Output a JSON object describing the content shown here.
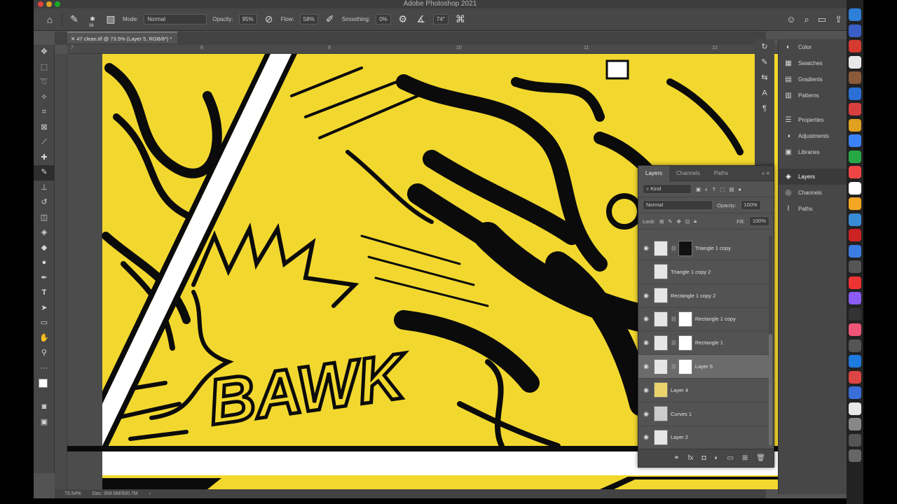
{
  "window": {
    "title": "Adobe Photoshop 2021"
  },
  "options_bar": {
    "brush_size": "36",
    "mode_label": "Mode:",
    "mode_value": "Normal",
    "opacity_label": "Opacity:",
    "opacity_value": "95%",
    "flow_label": "Flow:",
    "flow_value": "58%",
    "smoothing_label": "Smoothing:",
    "smoothing_value": "0%",
    "angle_value": "74°"
  },
  "document": {
    "tab_title": "47 clean.tif @ 73.5% (Layer 5, RGB/8*) *"
  },
  "ruler": {
    "ticks": [
      "7",
      "8",
      "9",
      "10",
      "11",
      "12"
    ]
  },
  "status": {
    "zoom": "73.54%",
    "doc_info": "Doc: 358.5M/500.7M"
  },
  "artwork": {
    "sfx_text": "BAWK"
  },
  "side_panel": {
    "group1": [
      {
        "icon": "color-icon",
        "label": "Color"
      },
      {
        "icon": "swatches-icon",
        "label": "Swatches"
      },
      {
        "icon": "gradients-icon",
        "label": "Gradients"
      },
      {
        "icon": "patterns-icon",
        "label": "Patterns"
      }
    ],
    "group2": [
      {
        "icon": "properties-icon",
        "label": "Properties"
      },
      {
        "icon": "adjustments-icon",
        "label": "Adjustments"
      },
      {
        "icon": "libraries-icon",
        "label": "Libraries"
      }
    ],
    "group3": [
      {
        "icon": "layers-icon",
        "label": "Layers"
      },
      {
        "icon": "channels-icon",
        "label": "Channels"
      },
      {
        "icon": "paths-icon",
        "label": "Paths"
      }
    ]
  },
  "layers_panel": {
    "tabs": [
      "Layers",
      "Channels",
      "Paths"
    ],
    "filter_label": "Kind",
    "blend_mode": "Normal",
    "opacity_label": "Opacity:",
    "opacity_value": "100%",
    "lock_label": "Lock:",
    "fill_label": "Fill:",
    "fill_value": "100%",
    "layers": [
      {
        "name": "Triangle 1 copy",
        "visible": true,
        "mask": true,
        "mask_color": "#111111",
        "selected": false
      },
      {
        "name": "Triangle 1 copy 2",
        "visible": false,
        "mask": false,
        "selected": false
      },
      {
        "name": "Rectangle 1 copy 2",
        "visible": true,
        "mask": false,
        "selected": false
      },
      {
        "name": "Rectangle 1 copy",
        "visible": true,
        "mask": true,
        "mask_color": "#ffffff",
        "selected": false
      },
      {
        "name": "Rectangle 1",
        "visible": true,
        "mask": true,
        "mask_color": "#ffffff",
        "selected": false
      },
      {
        "name": "Layer 5",
        "visible": true,
        "mask": true,
        "mask_color": "#ffffff",
        "selected": true
      },
      {
        "name": "Layer 4",
        "visible": true,
        "mask": false,
        "thumb_color": "#e8d46a",
        "selected": false
      },
      {
        "name": "Curves 1",
        "visible": true,
        "mask": false,
        "thumb_color": "#cccccc",
        "selected": false
      },
      {
        "name": "Layer 2",
        "visible": true,
        "mask": false,
        "selected": false
      }
    ]
  },
  "colors": {
    "canvas_yellow": "#f2d82e",
    "ink": "#0b0b0b",
    "ui_dark": "#474747",
    "ui_mid": "#535353"
  }
}
